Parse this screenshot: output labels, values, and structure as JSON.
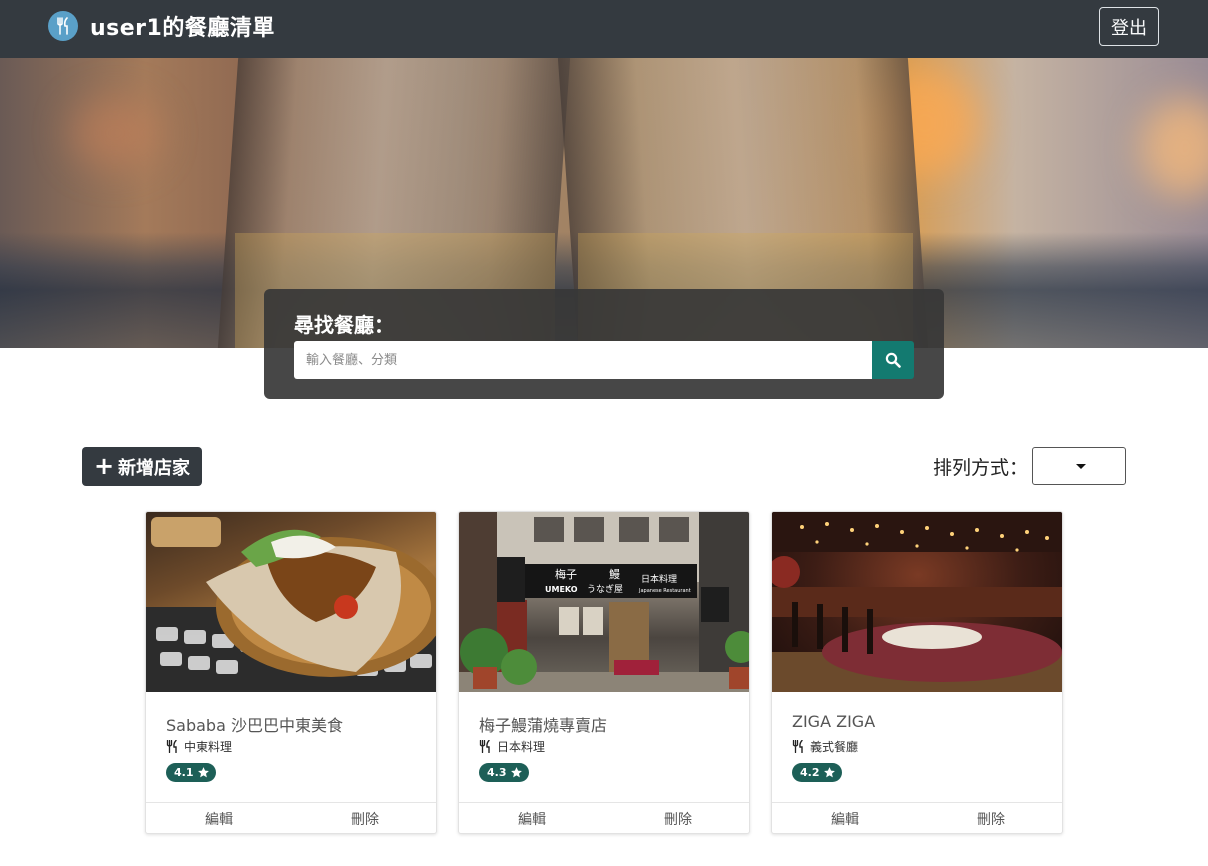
{
  "navbar": {
    "title": "user1的餐廳清單",
    "logout_label": "登出"
  },
  "search": {
    "label": "尋找餐廳：",
    "placeholder": "輸入餐廳、分類"
  },
  "toolbar": {
    "add_label": "新增店家",
    "sort_label": "排列方式：",
    "sort_value": ""
  },
  "restaurants": [
    {
      "name": "Sababa 沙巴巴中東美食",
      "category": "中東料理",
      "rating": "4.1",
      "edit_label": "編輯",
      "delete_label": "刪除"
    },
    {
      "name": "梅子鰻蒲燒專賣店",
      "category": "日本料理",
      "rating": "4.3",
      "edit_label": "編輯",
      "delete_label": "刪除"
    },
    {
      "name": "ZIGA ZIGA",
      "category": "義式餐廳",
      "rating": "4.2",
      "edit_label": "編輯",
      "delete_label": "刪除"
    }
  ],
  "store_sign": {
    "name": "梅子",
    "eel": "鰻",
    "umeko": "UMEKO",
    "unagiya": "うなぎ屋",
    "cuisine": "日本料理",
    "cuisine_en": "Japanese Restaurant"
  },
  "colors": {
    "navbar": "#343a40",
    "accent": "#137a70",
    "badge": "#1d5f57"
  },
  "icons": {
    "brand": "utensils-icon",
    "search": "search-icon",
    "add": "plus-icon",
    "category": "utensils-icon",
    "rating": "star-icon",
    "sort": "caret-down-icon"
  }
}
